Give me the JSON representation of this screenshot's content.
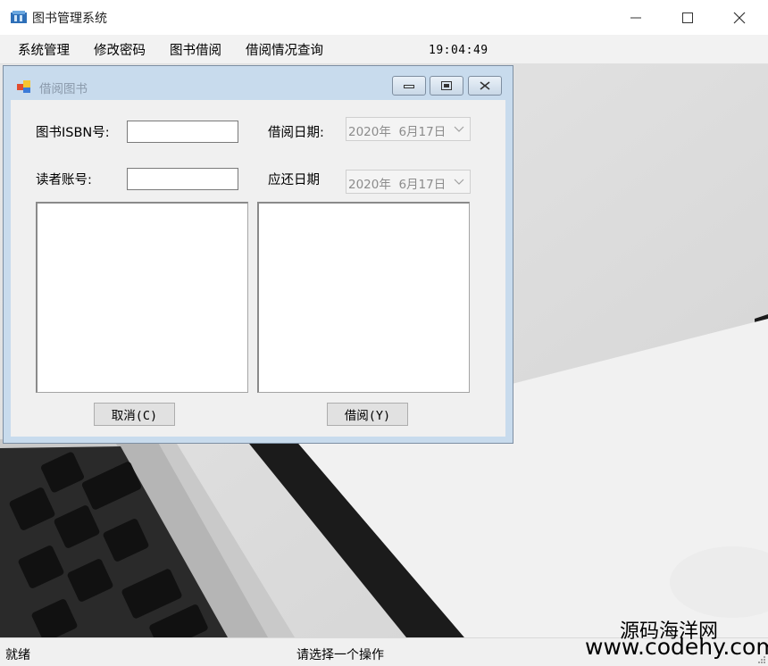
{
  "window": {
    "title": "图书管理系统",
    "caption_buttons": [
      "minimize-icon",
      "maximize-icon",
      "close-icon"
    ]
  },
  "menu": {
    "items": [
      {
        "label": "系统管理"
      },
      {
        "label": "修改密码"
      },
      {
        "label": "图书借阅"
      },
      {
        "label": "借阅情况查询"
      }
    ],
    "clock": "19:04:49"
  },
  "dialog": {
    "title": "借阅图书",
    "isbn_label": "图书ISBN号:",
    "isbn_value": "",
    "reader_label": "读者账号:",
    "reader_value": "",
    "borrow_date_label": "借阅日期:",
    "borrow_date_value": "2020年  6月17日",
    "due_date_label": "应还日期",
    "due_date_value": "2020年  6月17日",
    "cancel_label": "取消(C)",
    "borrow_label": "借阅(Y)"
  },
  "status": {
    "left": "就绪",
    "center": "请选择一个操作"
  },
  "watermark": {
    "line1": "源码海洋网",
    "line2": "www.codehy.com"
  },
  "colors": {
    "dialog_frame": "#c8dbed",
    "client_bg": "#f0f0f0",
    "menu_bg": "#f2f2f2"
  }
}
